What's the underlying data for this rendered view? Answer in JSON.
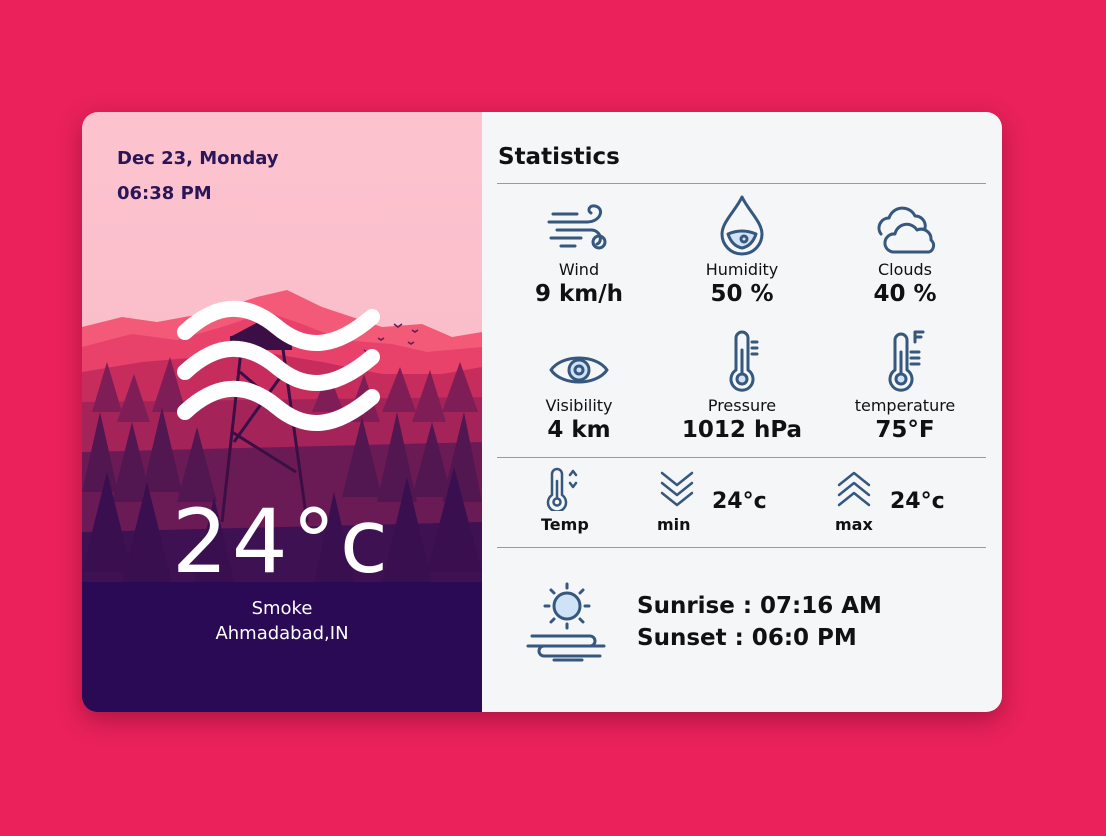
{
  "left_panel": {
    "date": "Dec 23, Monday",
    "time": "06:38 PM",
    "temperature": "24°c",
    "condition": "Smoke",
    "location": "Ahmadabad,IN",
    "icon": "wind-waves-icon"
  },
  "statistics": {
    "title": "Statistics",
    "items": [
      {
        "label": "Wind",
        "value": "9 km/h",
        "icon": "wind-icon"
      },
      {
        "label": "Humidity",
        "value": "50 %",
        "icon": "humidity-drop-icon"
      },
      {
        "label": "Clouds",
        "value": "40 %",
        "icon": "clouds-icon"
      },
      {
        "label": "Visibility",
        "value": "4 km",
        "icon": "eye-icon"
      },
      {
        "label": "Pressure",
        "value": "1012 hPa",
        "icon": "thermometer-icon"
      },
      {
        "label": "temperature",
        "value": "75°F",
        "icon": "thermometer-fahrenheit-icon"
      }
    ]
  },
  "temp_range": {
    "temp_label": "Temp",
    "min_label": "min",
    "min_value": "24°c",
    "max_label": "max",
    "max_value": "24°c"
  },
  "sun": {
    "sunrise": "Sunrise : 07:16 AM",
    "sunset": "Sunset : 06:0 PM",
    "icon": "sunrise-sunset-icon"
  },
  "colors": {
    "background": "#ea215b",
    "icon_stroke": "#36577e",
    "left_text": "#2a1657"
  }
}
